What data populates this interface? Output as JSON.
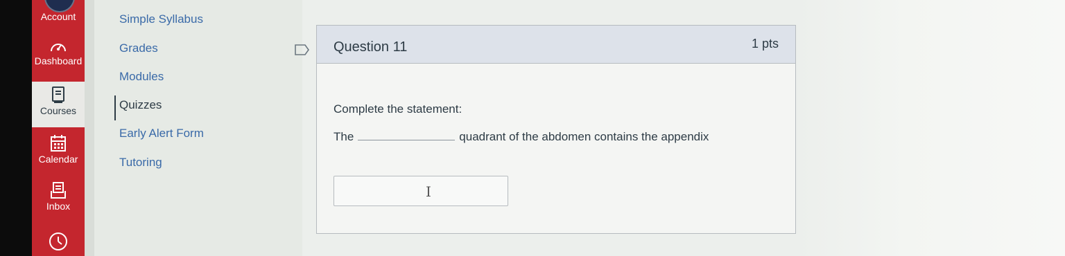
{
  "global_nav": {
    "items": [
      {
        "label": "Account",
        "icon": "account-icon"
      },
      {
        "label": "Dashboard",
        "icon": "dashboard-icon"
      },
      {
        "label": "Courses",
        "icon": "courses-icon"
      },
      {
        "label": "Calendar",
        "icon": "calendar-icon"
      },
      {
        "label": "Inbox",
        "icon": "inbox-icon"
      },
      {
        "label": "",
        "icon": "history-icon"
      }
    ],
    "accent_color": "#c4262e"
  },
  "course_nav": {
    "links": [
      {
        "label": "Simple Syllabus"
      },
      {
        "label": "Grades"
      },
      {
        "label": "Modules"
      },
      {
        "label": "Quizzes"
      },
      {
        "label": "Early Alert Form"
      },
      {
        "label": "Tutoring"
      }
    ],
    "active": "Quizzes"
  },
  "question": {
    "title": "Question 11",
    "points": "1 pts",
    "instruction": "Complete the statement:",
    "statement_before": "The",
    "statement_after": "quadrant of the abdomen contains the appendix",
    "answer_value": ""
  }
}
